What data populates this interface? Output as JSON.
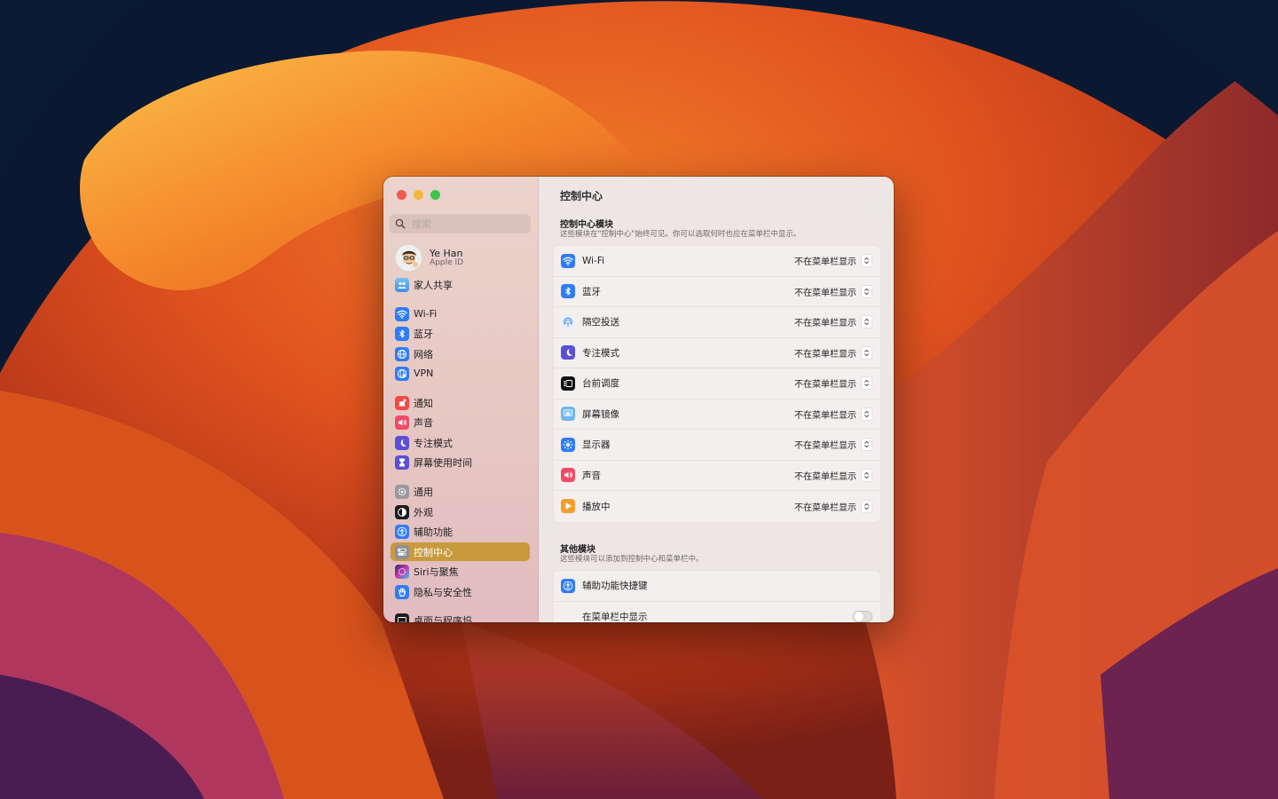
{
  "colors": {
    "accent": "#c99a3d"
  },
  "sidebar": {
    "search_placeholder": "搜索",
    "account": {
      "name": "Ye Han",
      "subtitle": "Apple ID"
    },
    "family": {
      "label": "家人共享",
      "icon": "family-icon"
    },
    "items": [
      {
        "label": "Wi-Fi",
        "icon": "wifi-icon"
      },
      {
        "label": "蓝牙",
        "icon": "bluetooth-icon"
      },
      {
        "label": "网络",
        "icon": "network-icon"
      },
      {
        "label": "VPN",
        "icon": "vpn-icon"
      },
      {
        "label": "通知",
        "icon": "notification-icon"
      },
      {
        "label": "声音",
        "icon": "sound-icon"
      },
      {
        "label": "专注模式",
        "icon": "focus-icon"
      },
      {
        "label": "屏幕使用时间",
        "icon": "screen-time-icon"
      },
      {
        "label": "通用",
        "icon": "general-icon"
      },
      {
        "label": "外观",
        "icon": "appearance-icon"
      },
      {
        "label": "辅助功能",
        "icon": "accessibility-icon"
      },
      {
        "label": "控制中心",
        "icon": "control-center-icon",
        "selected": true
      },
      {
        "label": "Siri与聚焦",
        "icon": "siri-icon"
      },
      {
        "label": "隐私与安全性",
        "icon": "privacy-icon"
      },
      {
        "label": "桌面与程序坞",
        "icon": "desktop-dock-icon"
      }
    ]
  },
  "main": {
    "title": "控制中心",
    "modules_section": {
      "title": "控制中心模块",
      "subtitle": "这些模块在\"控制中心\"始终可见。你可以选取何时也应在菜单栏中显示。"
    },
    "modules": [
      {
        "label": "Wi-Fi",
        "value": "不在菜单栏显示",
        "icon": "wifi-icon"
      },
      {
        "label": "蓝牙",
        "value": "不在菜单栏显示",
        "icon": "bluetooth-icon"
      },
      {
        "label": "隔空投送",
        "value": "不在菜单栏显示",
        "icon": "airdrop-icon"
      },
      {
        "label": "专注模式",
        "value": "不在菜单栏显示",
        "icon": "focus-icon"
      },
      {
        "label": "台前调度",
        "value": "不在菜单栏显示",
        "icon": "stage-manager-icon"
      },
      {
        "label": "屏幕镜像",
        "value": "不在菜单栏显示",
        "icon": "screen-mirroring-icon"
      },
      {
        "label": "显示器",
        "value": "不在菜单栏显示",
        "icon": "display-icon"
      },
      {
        "label": "声音",
        "value": "不在菜单栏显示",
        "icon": "sound-icon"
      },
      {
        "label": "播放中",
        "value": "不在菜单栏显示",
        "icon": "now-playing-icon"
      }
    ],
    "other_section": {
      "title": "其他模块",
      "subtitle": "这些模块可以添加到控制中心和菜单栏中。"
    },
    "other_modules": {
      "accessibility_shortcuts": {
        "label": "辅助功能快捷键",
        "icon": "accessibility-icon"
      },
      "show_in_menu_bar": {
        "label": "在菜单栏中显示",
        "enabled": false
      }
    }
  }
}
